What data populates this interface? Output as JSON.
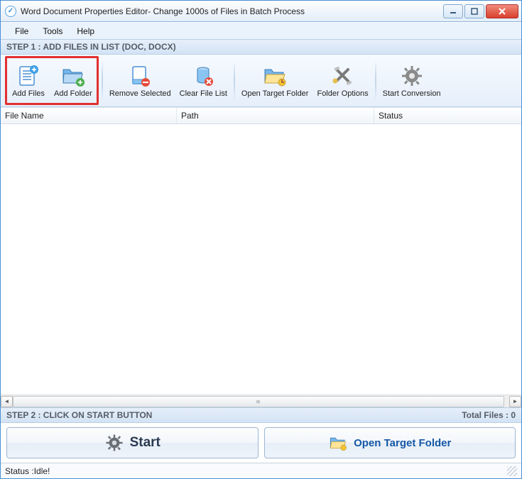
{
  "title": "Word Document Properties Editor- Change 1000s of Files in Batch Process",
  "menu": {
    "file": "File",
    "tools": "Tools",
    "help": "Help"
  },
  "step1": "STEP 1 : ADD FILES IN LIST (DOC, DOCX)",
  "toolbar": {
    "add_files": "Add Files",
    "add_folder": "Add Folder",
    "remove_selected": "Remove Selected",
    "clear_file_list": "Clear File List",
    "open_target_folder": "Open Target Folder",
    "folder_options": "Folder Options",
    "start_conversion": "Start Conversion"
  },
  "columns": {
    "file_name": "File Name",
    "path": "Path",
    "status": "Status"
  },
  "step2": "STEP 2 : CLICK ON START BUTTON",
  "total_files": "Total Files : 0",
  "actions": {
    "start": "Start",
    "open_target_folder": "Open Target Folder"
  },
  "status": {
    "label": "Status  :",
    "value": " Idle!"
  }
}
